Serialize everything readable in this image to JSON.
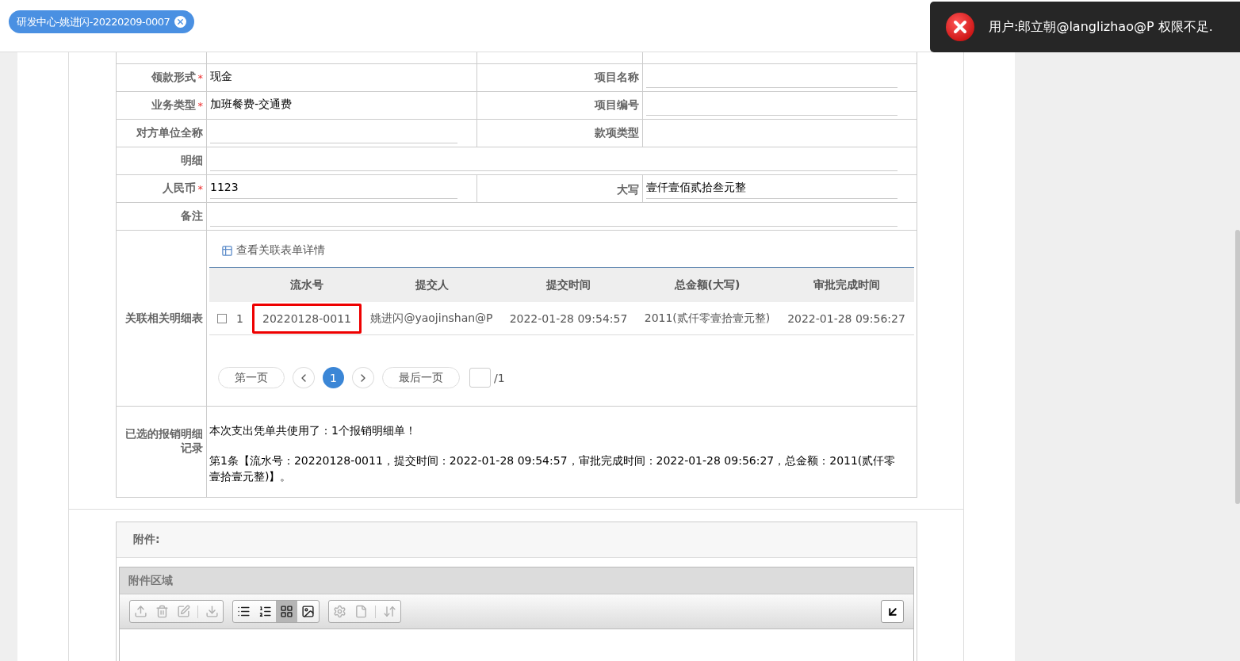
{
  "tab": {
    "label": "研发中心-姚进闪-20220209-0007",
    "selected": true
  },
  "toast": {
    "message": "用户:郎立朝@langlizhao@P 权限不足."
  },
  "form": {
    "rows": [
      {
        "kind": "split",
        "cells": [
          {
            "label": "领款形式",
            "required_mark": "*",
            "value": "现金",
            "underlined": false
          },
          {
            "label": "项目名称",
            "underlined": true
          }
        ]
      },
      {
        "kind": "split",
        "cells": [
          {
            "label": "业务类型",
            "required_mark": "*",
            "value": "加班餐费-交通费",
            "underlined": false
          },
          {
            "label": "项目编号",
            "underlined": true
          }
        ]
      },
      {
        "kind": "split",
        "cells": [
          {
            "label": "对方单位全称",
            "underlined": true
          },
          {
            "label": "款项类型",
            "underlined": false
          }
        ]
      },
      {
        "kind": "wide",
        "cells": [
          {
            "label": "明细",
            "underlined": true
          }
        ]
      },
      {
        "kind": "split",
        "cells": [
          {
            "label": "人民币",
            "required_mark": "*",
            "value": "1123",
            "underlined": true
          },
          {
            "label": "大写",
            "value": "壹仟壹佰贰拾叁元整",
            "underlined": true
          }
        ]
      },
      {
        "kind": "wide",
        "cells": [
          {
            "label": "备注",
            "underlined": true
          }
        ]
      }
    ]
  },
  "related": {
    "label": "关联相关明细表",
    "link": "查看关联表单详情",
    "columns": [
      "流水号",
      "提交人",
      "提交时间",
      "总金额(大写)",
      "审批完成时间"
    ],
    "rows": [
      {
        "checked": false,
        "index": "1",
        "highlighted": true,
        "cells": [
          "20220128-0011",
          "姚进闪@yaojinshan@P",
          "2022-01-28 09:54:57",
          "2011(贰仟零壹拾壹元整)",
          "2022-01-28 09:56:27"
        ]
      }
    ],
    "pagination": {
      "first": "第一页",
      "last": "最后一页",
      "pages": [
        {
          "label": "1",
          "selected": true
        }
      ],
      "total": "/1"
    }
  },
  "selected_records": {
    "label": "已选的报销明细记录",
    "lines": [
      "本次支出凭单共使用了：1个报销明细单！",
      "第1条【流水号：20220128-0011，提交时间：2022-01-28 09:54:57，审批完成时间：2022-01-28 09:56:27，总金额：2011(贰仟零壹拾壹元整)】。"
    ]
  },
  "attachments": {
    "title": "附件:",
    "panel_title": "附件区域",
    "toolbar": [
      [
        {
          "kind": "upload",
          "disabled": true,
          "selected": false
        },
        {
          "kind": "delete",
          "disabled": true,
          "selected": false
        },
        {
          "kind": "edit",
          "disabled": true,
          "selected": false
        },
        {
          "kind": "separator"
        },
        {
          "kind": "download",
          "disabled": true,
          "selected": false
        }
      ],
      [
        {
          "kind": "bullets",
          "disabled": false,
          "selected": false
        },
        {
          "kind": "numbered",
          "disabled": false,
          "selected": false
        },
        {
          "kind": "grid",
          "disabled": false,
          "selected": true
        },
        {
          "kind": "image",
          "disabled": false,
          "selected": false
        }
      ],
      [
        {
          "kind": "settings",
          "disabled": true,
          "selected": false
        },
        {
          "kind": "file",
          "disabled": true,
          "selected": false
        },
        {
          "kind": "separator"
        },
        {
          "kind": "sort",
          "disabled": true,
          "selected": false
        }
      ]
    ]
  }
}
